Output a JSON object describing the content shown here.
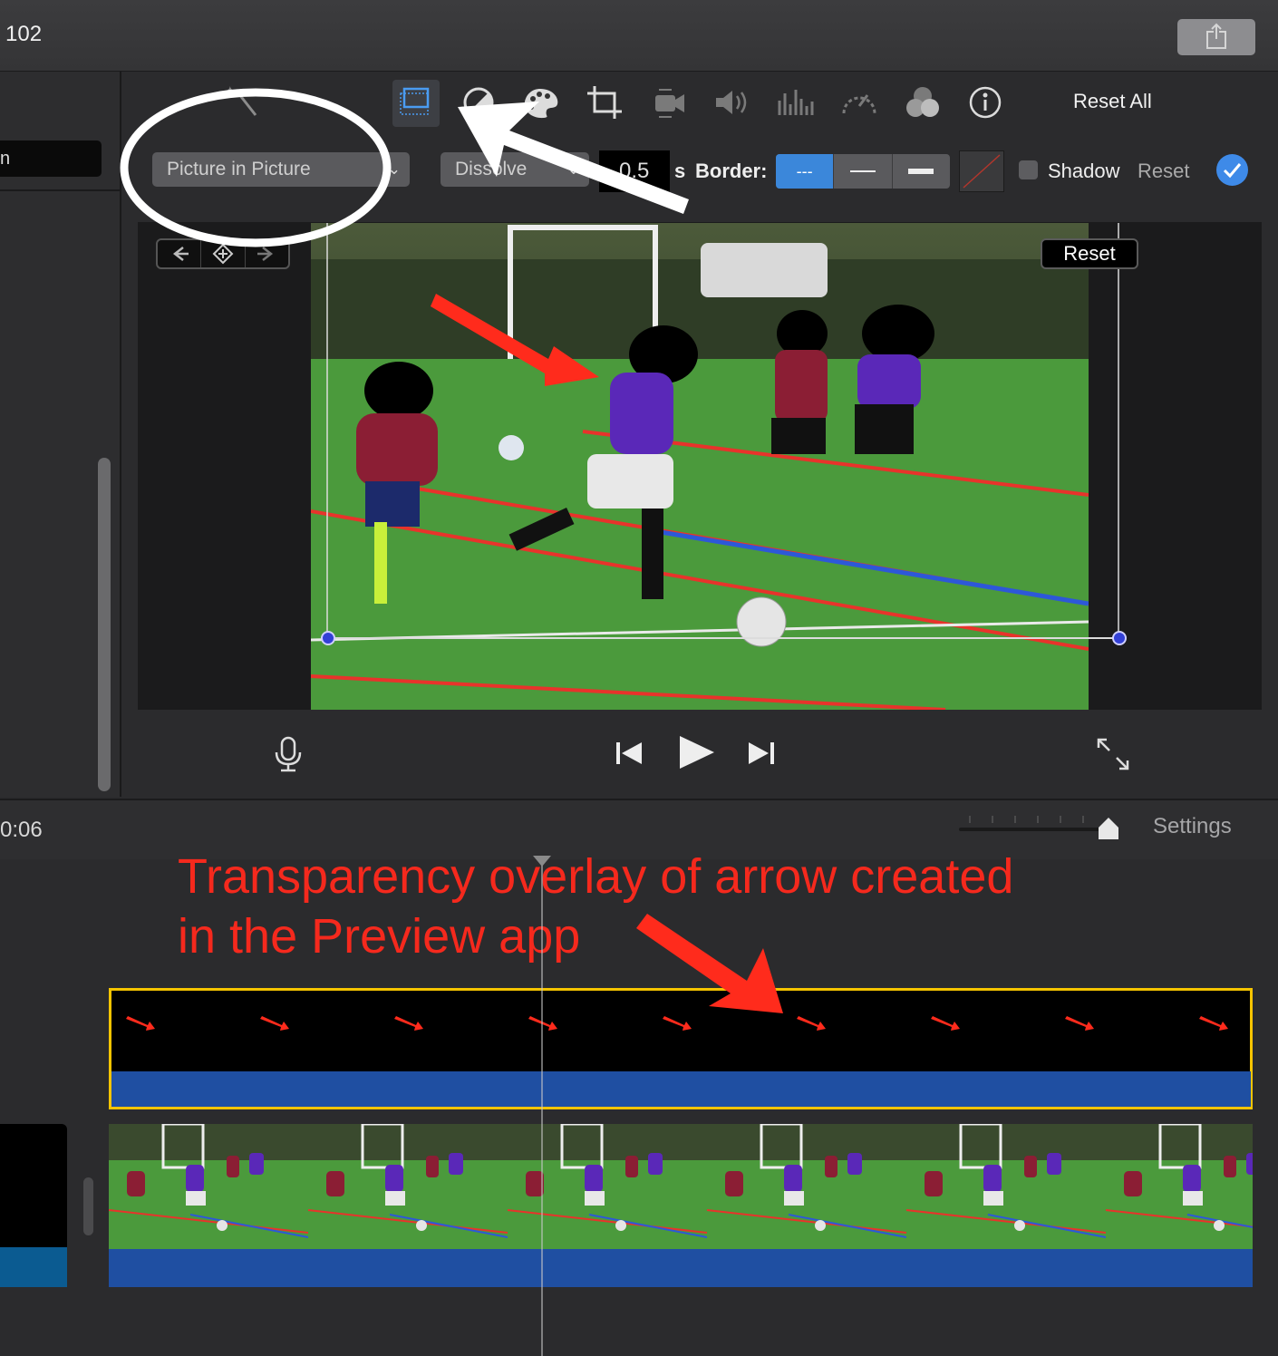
{
  "window": {
    "title": "102"
  },
  "left_panel": {
    "search_value": "n"
  },
  "toolbar": {
    "tools": [
      "video-overlay-icon",
      "color-balance-icon",
      "color-palette-icon",
      "crop-icon",
      "stabilization-icon",
      "volume-icon",
      "equalizer-icon",
      "speed-icon",
      "clip-filter-icon",
      "info-icon"
    ],
    "reset_all_label": "Reset All",
    "accent_color": "#3b87da"
  },
  "overlay_settings": {
    "style_value": "Picture in Picture",
    "transition_value": "Dissolve",
    "duration_value": "0.5",
    "duration_unit": "s",
    "border_label": "Border:",
    "border_options": [
      "---",
      "—",
      "▬"
    ],
    "border_selected": "---",
    "shadow_label": "Shadow",
    "reset_label": "Reset"
  },
  "viewer": {
    "reset_label": "Reset"
  },
  "timeline": {
    "timecode": "0:06",
    "settings_label": "Settings"
  },
  "annotation": {
    "text_line1": "Transparency overlay of arrow created",
    "text_line2": "in the Preview app",
    "color": "#f5291d"
  }
}
